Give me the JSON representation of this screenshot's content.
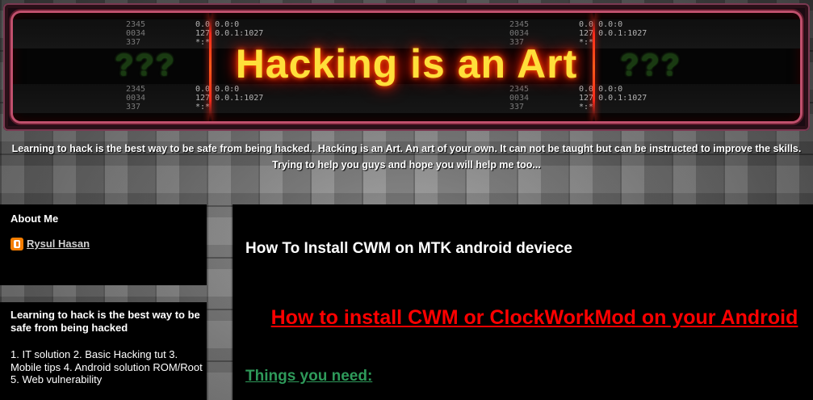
{
  "header": {
    "title": "Hacking is an Art",
    "left_marks": "???",
    "right_marks": "???",
    "code_left_top": "2345\n0034\n337",
    "code_left_mid": "0.0 0.0:0\n127 0.0.1:1027\n*:*",
    "code_left_bot": "2345\n0034\n337",
    "code_left_bot2": "0.0 0.0:0\n127 0.0.1:1027\n*:*",
    "code_right_top": "2345\n0034\n337",
    "code_right_mid": "0.0 0.0:0\n127 0.0.1:1027\n*:*",
    "code_right_bot": "2345\n0034\n337",
    "code_right_bot2": "0.0 0.0:0\n127 0.0.1:1027\n*:*"
  },
  "description": "Learning to hack is the best way to be safe from being hacked.. Hacking is an Art. An art of your own. It can not be taught but can be instructed to improve the skills. Trying to help you guys and hope you will help me too...",
  "sidebar": {
    "about_title": "About Me",
    "profile_name": "Rysul Hasan",
    "profile_icon": "blogger-icon",
    "widget_title": "Learning to hack is the best way to be safe from being hacked",
    "widget_text": "1. IT solution 2. Basic Hacking tut 3. Mobile tips 4. Android solution ROM/Root 5. Web vulnerability"
  },
  "post": {
    "title": "How To Install CWM on MTK android deviece",
    "heading": "How to install CWM or ClockWorkMod on your Android",
    "subheading": "Things you need:"
  },
  "colors": {
    "title_glow": "#ffdf3a",
    "heading_red": "#ff0000",
    "subheading_green": "#2e9a5a",
    "panel_bg": "#000000"
  }
}
